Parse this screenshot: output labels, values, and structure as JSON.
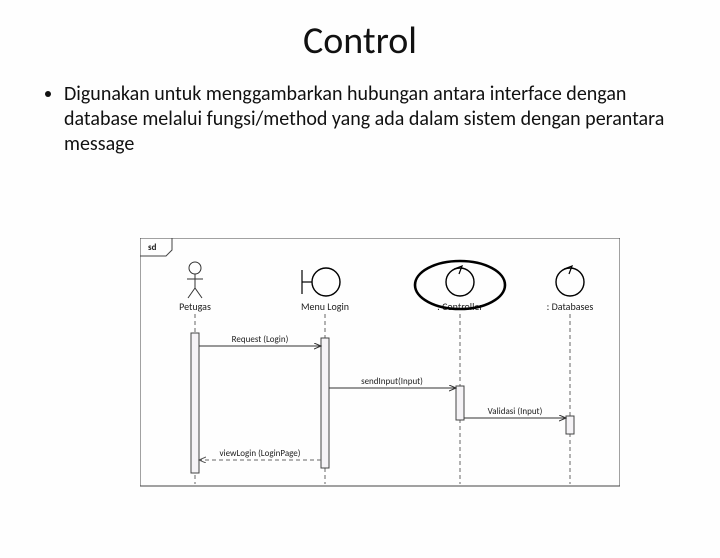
{
  "title": "Control",
  "bullet": "Digunakan untuk menggambarkan hubungan antara interface dengan database melalui fungsi/method yang ada dalam sistem dengan perantara message",
  "diagram": {
    "frame_label": "sd",
    "lifelines": {
      "petugas": "Petugas",
      "menu_login": "Menu Login",
      "controller": ": Controller",
      "databases": ": Databases"
    },
    "messages": {
      "m1": "Request (Login)",
      "m2": "sendInput(Input)",
      "m3": "Validasi (Input)",
      "m4": "viewLogin (LoginPage)"
    }
  }
}
